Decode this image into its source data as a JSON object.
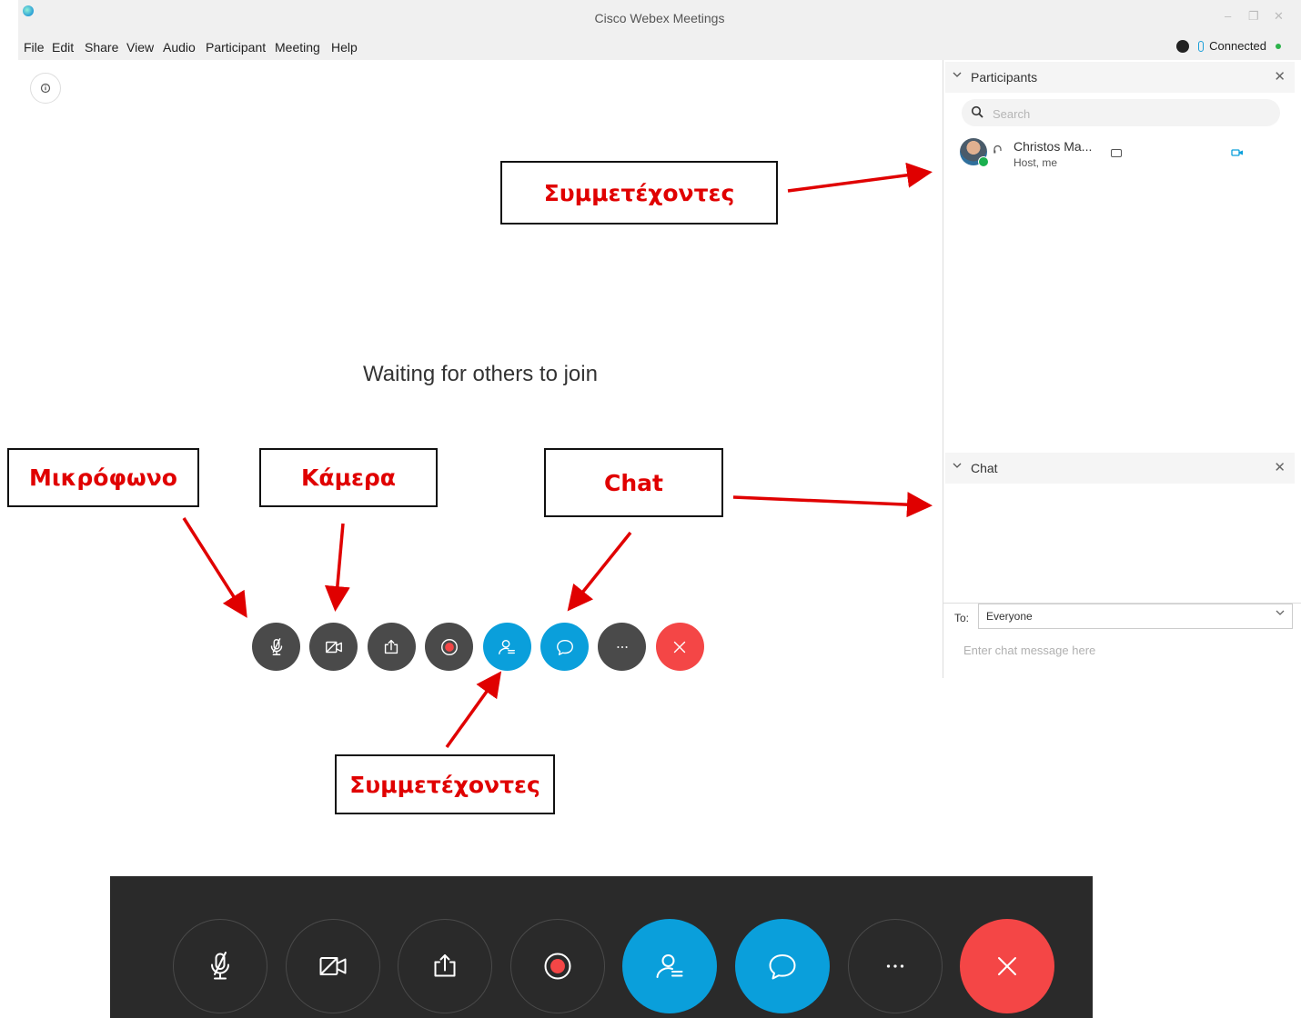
{
  "window": {
    "title": "Cisco Webex Meetings",
    "minimize": "–",
    "maximize": "❐",
    "close": "✕"
  },
  "menu": [
    "File",
    "Edit",
    "Share",
    "View",
    "Audio",
    "Participant",
    "Meeting",
    "Help"
  ],
  "status": {
    "label": "Connected"
  },
  "main": {
    "waiting_text": "Waiting for others to join",
    "info_icon": "info-icon"
  },
  "participants_panel": {
    "title": "Participants",
    "search_placeholder": "Search",
    "participants": [
      {
        "name": "Christos Ma...",
        "role": "Host, me"
      }
    ]
  },
  "chat_panel": {
    "title": "Chat",
    "to_label": "To:",
    "to_value": "Everyone",
    "input_placeholder": "Enter chat message here"
  },
  "controls": [
    {
      "name": "mute-button",
      "icon": "microphone-off-icon",
      "style": "dark"
    },
    {
      "name": "video-button",
      "icon": "video-off-icon",
      "style": "dark"
    },
    {
      "name": "share-button",
      "icon": "share-icon",
      "style": "dark"
    },
    {
      "name": "record-button",
      "icon": "record-icon",
      "style": "dark"
    },
    {
      "name": "participants-button",
      "icon": "participants-icon",
      "style": "blue"
    },
    {
      "name": "chat-button",
      "icon": "chat-icon",
      "style": "blue"
    },
    {
      "name": "more-button",
      "icon": "more-icon",
      "style": "dark"
    },
    {
      "name": "leave-button",
      "icon": "close-icon",
      "style": "red"
    }
  ],
  "annotations": {
    "participants_top": "Συμμετέχοντες",
    "microphone": "Μικρόφωνο",
    "camera": "Κάμερα",
    "chat": "Chat",
    "participants_bottom": "Συμμετέχοντες"
  },
  "colors": {
    "accent_blue": "#0a9fdb",
    "leave_red": "#f44646",
    "button_dark": "#4a4a4a",
    "annotation_red": "#e00000"
  }
}
